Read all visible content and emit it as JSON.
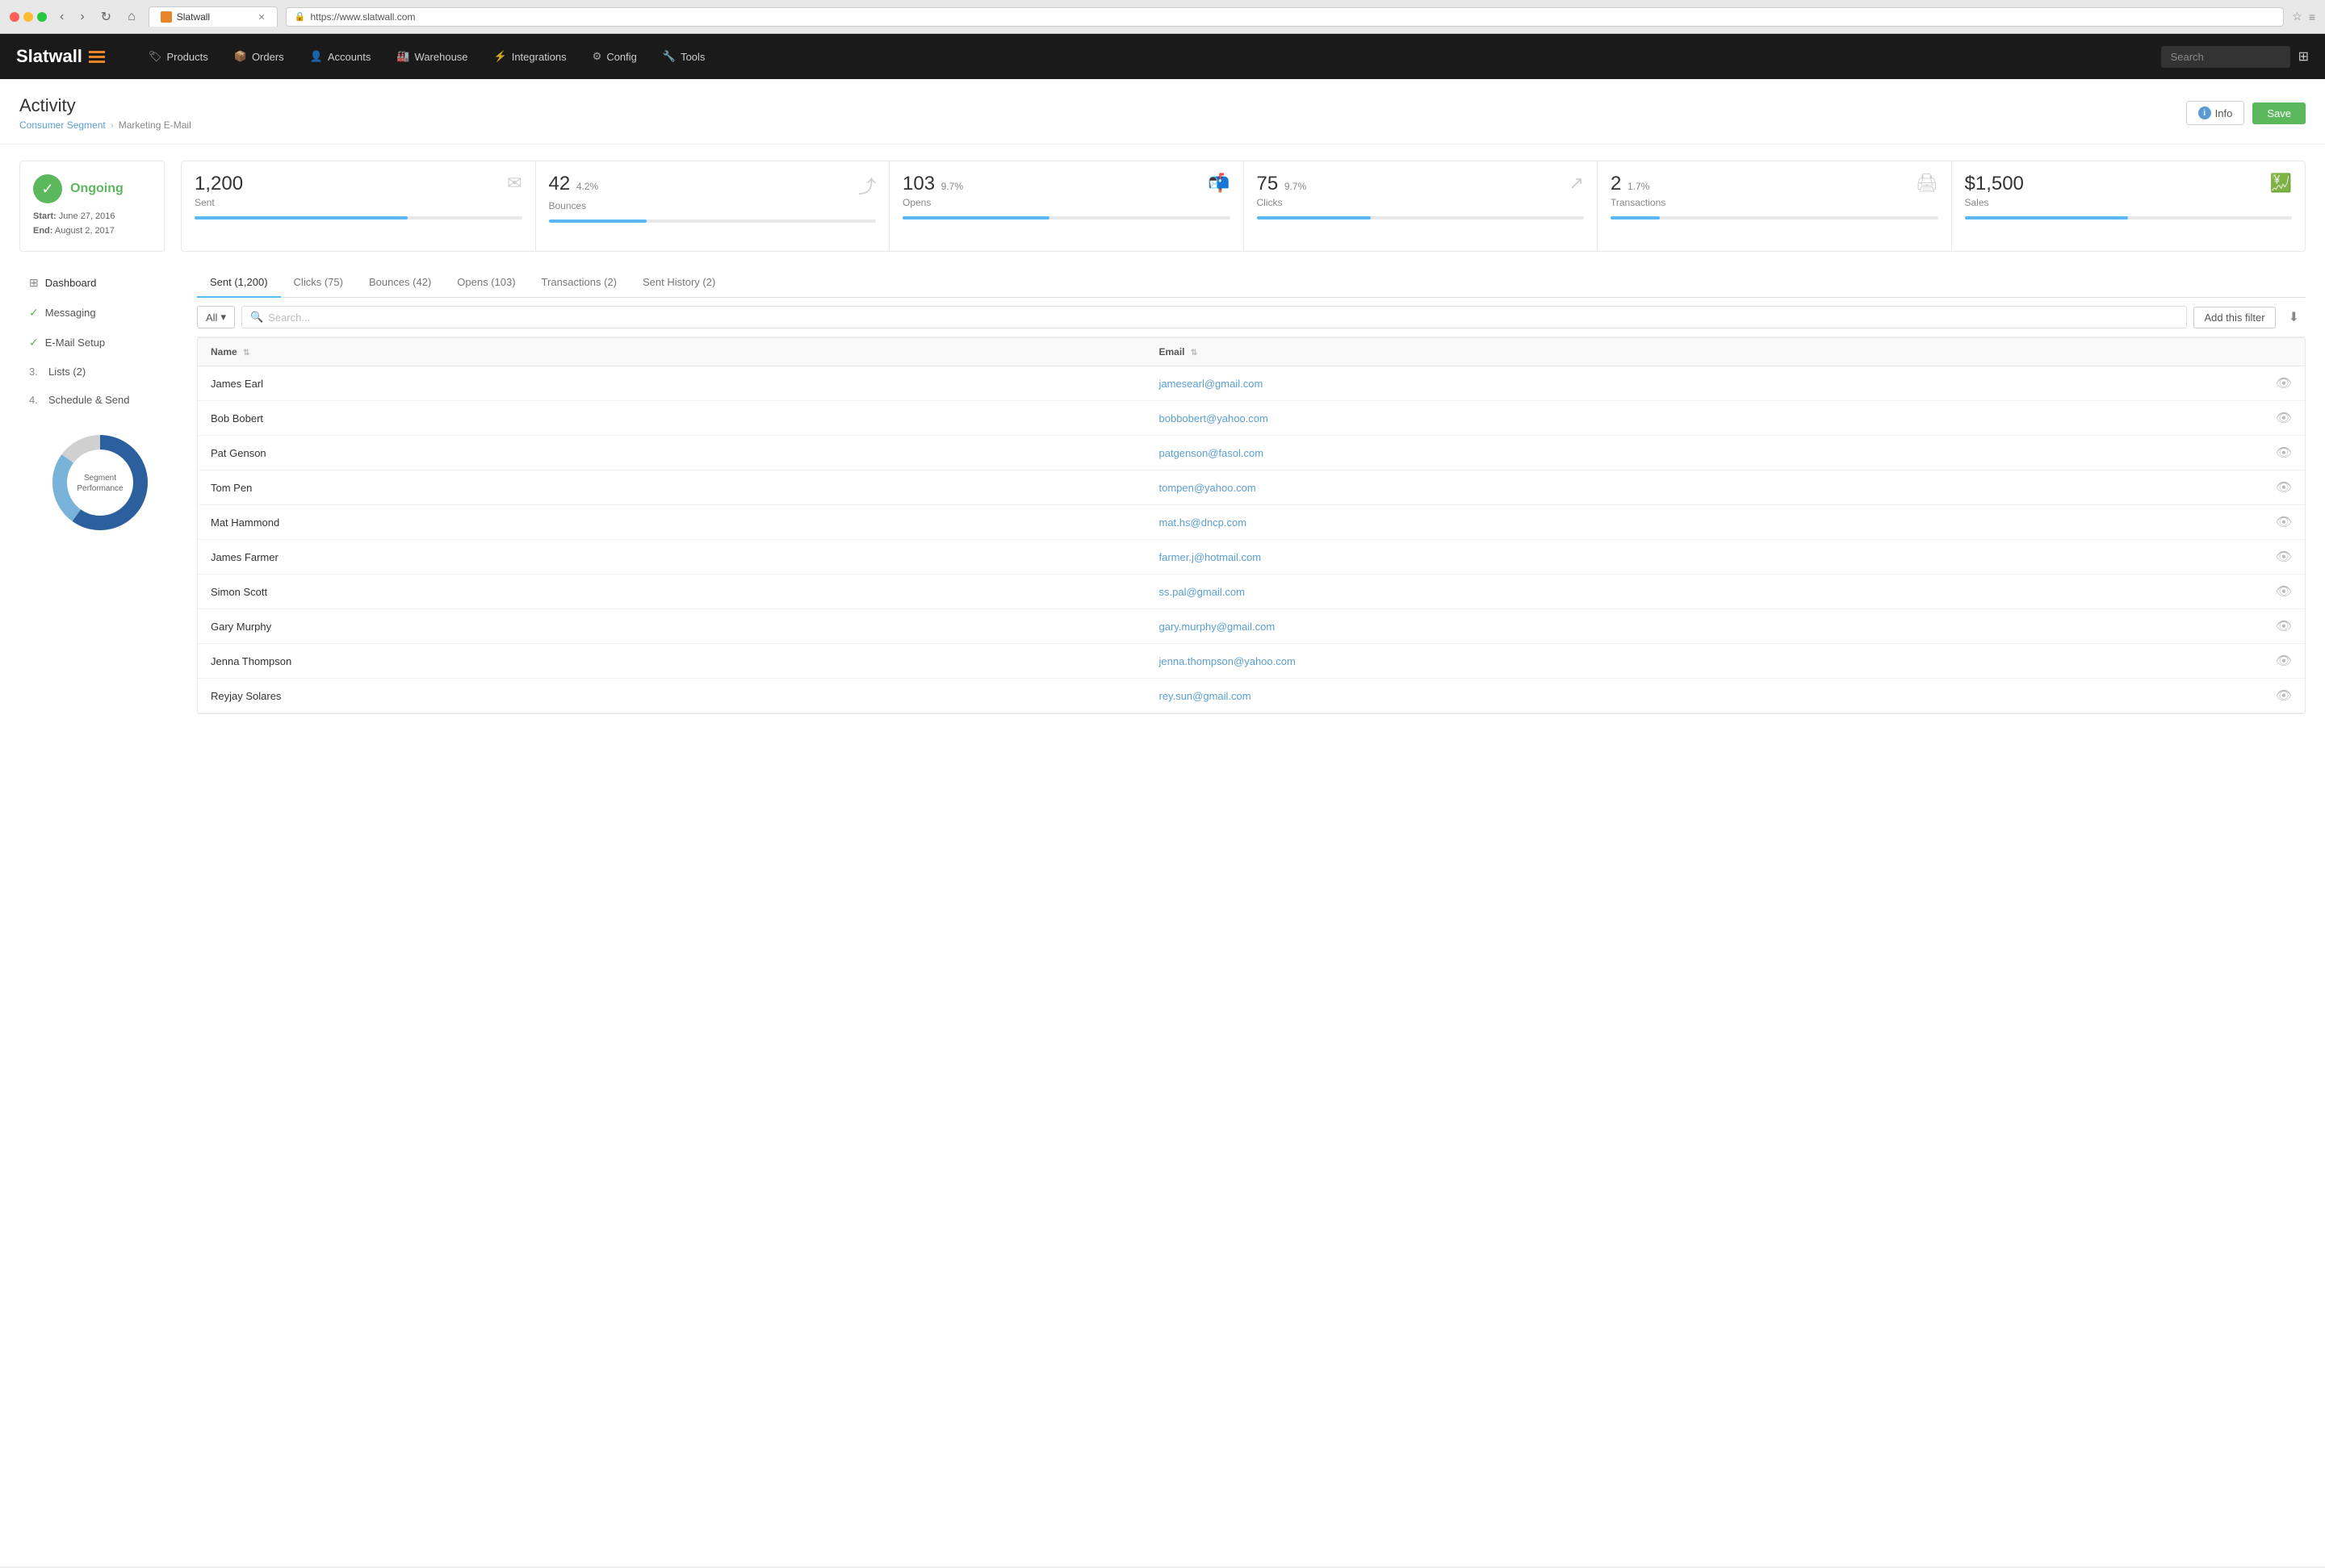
{
  "browser": {
    "url": "https://www.slatwall.com",
    "tab_title": "Slatwall",
    "tab_favicon": "S"
  },
  "navbar": {
    "logo_text": "Slatwall",
    "search_placeholder": "Search",
    "nav_items": [
      {
        "label": "Products",
        "icon": "🏷"
      },
      {
        "label": "Orders",
        "icon": "📦"
      },
      {
        "label": "Accounts",
        "icon": "👤"
      },
      {
        "label": "Warehouse",
        "icon": "🏭"
      },
      {
        "label": "Integrations",
        "icon": "⚡"
      },
      {
        "label": "Config",
        "icon": "⚙"
      },
      {
        "label": "Tools",
        "icon": "🔧"
      }
    ]
  },
  "page": {
    "title": "Activity",
    "breadcrumb": [
      "Consumer Segment",
      "Marketing E-Mail"
    ],
    "info_label": "Info",
    "save_label": "Save"
  },
  "status": {
    "label": "Ongoing",
    "start": "June 27, 2016",
    "end": "August 2, 2017"
  },
  "metrics": [
    {
      "value": "1,200",
      "pct": "",
      "label": "Sent",
      "bar_width": "65"
    },
    {
      "value": "42",
      "pct": "4.2%",
      "label": "Bounces",
      "bar_width": "30"
    },
    {
      "value": "103",
      "pct": "9.7%",
      "label": "Opens",
      "bar_width": "45"
    },
    {
      "value": "75",
      "pct": "9.7%",
      "label": "Clicks",
      "bar_width": "35"
    },
    {
      "value": "2",
      "pct": "1.7%",
      "label": "Transactions",
      "bar_width": "15"
    },
    {
      "value": "$1,500",
      "pct": "",
      "label": "Sales",
      "bar_width": "50"
    }
  ],
  "sidebar": {
    "items": [
      {
        "type": "check",
        "label": "Dashboard",
        "icon": "grid"
      },
      {
        "type": "check",
        "label": "Messaging"
      },
      {
        "type": "check",
        "label": "E-Mail Setup"
      },
      {
        "num": "3.",
        "label": "Lists (2)"
      },
      {
        "num": "4.",
        "label": "Schedule & Send"
      }
    ],
    "donut_label": "Segment\nPerformance"
  },
  "tabs": [
    {
      "label": "Sent (1,200)",
      "active": true
    },
    {
      "label": "Clicks (75)",
      "active": false
    },
    {
      "label": "Bounces (42)",
      "active": false
    },
    {
      "label": "Opens (103)",
      "active": false
    },
    {
      "label": "Transactions (2)",
      "active": false
    },
    {
      "label": "Sent History (2)",
      "active": false
    }
  ],
  "filter": {
    "select_label": "All",
    "search_placeholder": "Search...",
    "add_filter_label": "Add this filter"
  },
  "table": {
    "columns": [
      "Name",
      "Email"
    ],
    "rows": [
      {
        "name": "James Earl",
        "email": "jamesearl@gmail.com"
      },
      {
        "name": "Bob Bobert",
        "email": "bobbobert@yahoo.com"
      },
      {
        "name": "Pat Genson",
        "email": "patgenson@fasol.com"
      },
      {
        "name": "Tom Pen",
        "email": "tompen@yahoo.com"
      },
      {
        "name": "Mat Hammond",
        "email": "mat.hs@dncp.com"
      },
      {
        "name": "James Farmer",
        "email": "farmer.j@hotmail.com"
      },
      {
        "name": "Simon Scott",
        "email": "ss.pal@gmail.com"
      },
      {
        "name": "Gary Murphy",
        "email": "gary.murphy@gmail.com"
      },
      {
        "name": "Jenna Thompson",
        "email": "jenna.thompson@yahoo.com"
      },
      {
        "name": "Reyjay Solares",
        "email": "rey.sun@gmail.com"
      }
    ]
  }
}
